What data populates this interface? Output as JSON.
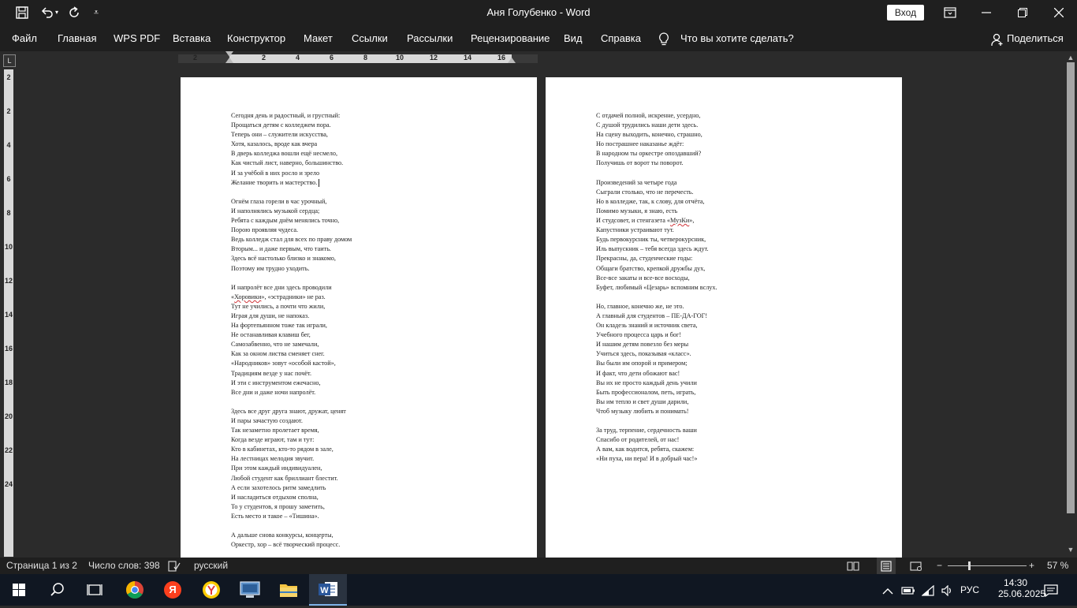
{
  "title_bar": {
    "title": "Аня Голубенко  -  Word",
    "signin_label": "Вход",
    "qat": {
      "save_icon": "save-icon",
      "undo_icon": "undo-icon",
      "redo_icon": "redo-icon",
      "customize_icon": "chevron-down-icon"
    },
    "window_buttons": {
      "ribbon_options": "ribbon-display-icon",
      "minimize": "minimize-icon",
      "restore": "restore-icon",
      "close": "close-icon"
    }
  },
  "menu": {
    "items": [
      "Файл",
      "Главная",
      "WPS PDF",
      "Вставка",
      "Конструктор",
      "Макет",
      "Ссылки",
      "Рассылки",
      "Рецензирование",
      "Вид",
      "Справка"
    ],
    "tell_me": "Что вы хотите сделать?",
    "share": "Поделиться"
  },
  "ruler": {
    "corner_label": "L",
    "h_numbers": [
      "2",
      "2",
      "4",
      "6",
      "8",
      "10",
      "12",
      "14",
      "16"
    ],
    "v_numbers": [
      "2",
      "2",
      "4",
      "6",
      "8",
      "10",
      "12",
      "14",
      "16",
      "18",
      "20",
      "22",
      "24"
    ]
  },
  "document": {
    "page1_lines": [
      "Сегодня день и радостный, и грустный:",
      "Прощаться детям с колледжем пора.",
      "Теперь они – служители искусства,",
      "Хотя, казалось, вроде как вчера",
      "В дверь колледжа вошли ещё несмело,",
      "Как чистый лист, наверно, большинство.",
      "И за учёбой в них росло и зрело",
      "Желание творить и мастерство.",
      "",
      "Огнём глаза горели в час урочный,",
      "И наполнялись музыкой сердца;",
      "Ребята с каждым днём менялись точно,",
      "Порою проявляя чудеса.",
      "Ведь колледж стал для всех по праву домом",
      "Вторым... и даже первым, что таить.",
      "Здесь всё настолько близко и знакомо,",
      "Поэтому им трудно уходить.",
      "",
      "И напролёт все дни здесь проводили",
      "«Хоровики», «эстрадники» не раз.",
      "Тут не учились, а почти что жили,",
      "Играя для души, не напоказ.",
      "На фортепьянном тоже так играли,",
      "Не останавливая клавиш бег,",
      "Самозабвенно, что не замечали,",
      "Как за окном листва сменяет снег.",
      "«Народников» зовут «особой кастой»,",
      "Традициям везде у нас почёт.",
      "И эти с инструментом ежечасно,",
      "Все дни и даже ночи напролёт.",
      "",
      "Здесь все друг друга знают, дружат, ценят",
      "И пары зачастую создают.",
      "Так незаметно пролетает время,",
      "Когда везде играют, там и тут:",
      "Кто в кабинетах, кто-то рядом в зале,",
      "На лестницах мелодия звучит.",
      "При этом каждый индивидуален,",
      "Любой студент как бриллиант блестит.",
      "А если захотелось ритм замедлить",
      "И насладиться отдыхом сполна,",
      "То у студентов, я прошу заметить,",
      "Есть место и такое – «Тишина».",
      "",
      "А дальше снова конкурсы, концерты,",
      "Оркестр, хор – всё творческий процесс."
    ],
    "page2_lines": [
      "С отдачей полной, искренне, усердно,",
      "С душой трудились наши дети здесь.",
      "На сцену выходить, конечно, страшно,",
      "Но пострашнее наказанье ждёт:",
      "В народном ты оркестре опоздавший?",
      "Получишь от ворот ты поворот.",
      "",
      "Произведений за четыре года",
      "Сыграли столько, что не перечесть.",
      "Но в колледже, так, к слову, для отчёта,",
      "Помимо музыки, я знаю, есть",
      "И студсовет, и стенгазета «МузКи»,",
      "Капустники устраивают тут.",
      "Будь первокурсник ты, четверокурсник,",
      "Иль выпускник – тебя всегда здесь ждут.",
      "Прекрасны, да, студенческие годы:",
      "Общаги братство, крепкой дружбы дух,",
      "Все-все закаты и все-все восходы,",
      "Буфет, любимый «Цезарь» вспомним вслух.",
      "",
      "Но, главное, конечно же, не это.",
      "А главный для студентов – ПЕ-ДА-ГОГ!",
      "Он кладезь знаний и источник света,",
      "Учебного процесса царь и бог!",
      "И нашим детям повезло без меры",
      "Учиться здесь, показывая «класс».",
      "Вы были им опорой и примером;",
      "И факт, что дети обожают вас!",
      "Вы их не просто каждый день учили",
      "Быть профессионалом, петь, играть,",
      "Вы им тепло и свет души дарили,",
      "Чтоб музыку любить и понимать!",
      "",
      "За труд, терпение, сердечность ваши",
      "Спасибо от родителей, от нас!",
      "А вам, как водится, ребята, скажем:",
      "«Ни пуха, ни пера! И в добрый час!»"
    ]
  },
  "status_bar": {
    "page_info": "Страница 1 из 2",
    "word_count": "Число слов: 398",
    "language": "русский",
    "zoom_percent": "57 %",
    "zoom_level": 0.57
  },
  "taskbar": {
    "apps": [
      {
        "name": "windows-start-icon",
        "color": "#ffffff"
      },
      {
        "name": "search-icon",
        "color": "#ffffff"
      },
      {
        "name": "task-view-icon",
        "color": "#ffffff"
      },
      {
        "name": "chrome-icon",
        "color": "#34a853"
      },
      {
        "name": "yandex-icon",
        "color": "#fc3f1d"
      },
      {
        "name": "yandex-browser-icon",
        "color": "#ffcc00"
      },
      {
        "name": "computer-icon",
        "color": "#5b8fc7"
      },
      {
        "name": "file-explorer-icon",
        "color": "#f5c542"
      },
      {
        "name": "word-icon",
        "color": "#2b579a"
      }
    ],
    "lang": "РУС",
    "time": "14:30",
    "date": "25.06.2025"
  },
  "colors": {
    "chrome_bg": "#1f1f1f",
    "canvas_bg": "#2b2b2b",
    "taskbar_bg": "#101722",
    "word_blue": "#2b579a"
  }
}
